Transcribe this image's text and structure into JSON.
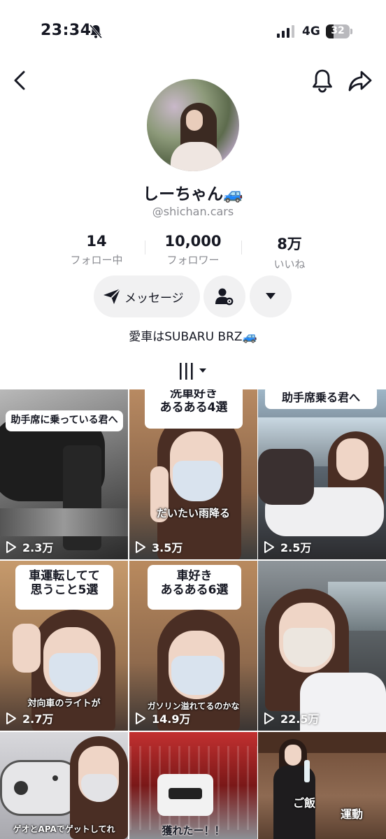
{
  "status_bar": {
    "time": "23:34",
    "network": "4G",
    "battery": "32",
    "battery_level": 0.32
  },
  "profile": {
    "display_name": "しーちゃん🚙",
    "username": "@shichan.cars",
    "stats": [
      {
        "value": "14",
        "label": "フォロー中"
      },
      {
        "value": "10,000",
        "label": "フォロワー"
      },
      {
        "value": "8万",
        "label": "いいね"
      }
    ],
    "message_label": "メッセージ",
    "bio": "愛車はSUBARU BRZ🚙"
  },
  "videos": [
    {
      "caption": "助手席に乗っている君へ",
      "overlay": "",
      "views": "2.3万"
    },
    {
      "caption": "洗車好き あるある4選",
      "overlay": "だいたい雨降る",
      "views": "3.5万"
    },
    {
      "caption": "助手席乗る君へ",
      "overlay": "",
      "views": "2.5万"
    },
    {
      "caption": "車運転してて 思うこと5選",
      "overlay": "対向車のライトが",
      "views": "2.7万"
    },
    {
      "caption": "車好き あるある6選",
      "overlay": "ガソリン溢れてるのかな",
      "views": "14.9万"
    },
    {
      "caption": "",
      "overlay": "",
      "views": "22.5万"
    },
    {
      "caption": "",
      "overlay": "ゲオとAPAでゲットしてれ",
      "views": ""
    },
    {
      "caption": "",
      "overlay": "獲れたー！！",
      "views": ""
    },
    {
      "caption": "",
      "overlay": "ご飯",
      "overlay2": "運動",
      "views": ""
    }
  ],
  "colors": {
    "text": "#161823",
    "muted": "#8a8b91",
    "button_bg": "#f1f1f2"
  }
}
